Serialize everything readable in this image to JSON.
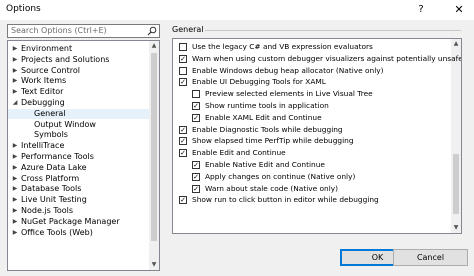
{
  "window": {
    "title": "Options",
    "help_glyph": "?",
    "close_glyph": "✕"
  },
  "search": {
    "placeholder": "Search Options (Ctrl+E)"
  },
  "tree": {
    "items": [
      {
        "label": "Environment",
        "arrow": "▶",
        "level": 0
      },
      {
        "label": "Projects and Solutions",
        "arrow": "▶",
        "level": 0
      },
      {
        "label": "Source Control",
        "arrow": "▶",
        "level": 0
      },
      {
        "label": "Work Items",
        "arrow": "▶",
        "level": 0
      },
      {
        "label": "Text Editor",
        "arrow": "▶",
        "level": 0
      },
      {
        "label": "Debugging",
        "arrow": "◢",
        "level": 0
      },
      {
        "label": "General",
        "arrow": "",
        "level": 1,
        "selected": true
      },
      {
        "label": "Output Window",
        "arrow": "",
        "level": 1
      },
      {
        "label": "Symbols",
        "arrow": "",
        "level": 1
      },
      {
        "label": "IntelliTrace",
        "arrow": "▶",
        "level": 0
      },
      {
        "label": "Performance Tools",
        "arrow": "▶",
        "level": 0
      },
      {
        "label": "Azure Data Lake",
        "arrow": "▶",
        "level": 0
      },
      {
        "label": "Cross Platform",
        "arrow": "▶",
        "level": 0
      },
      {
        "label": "Database Tools",
        "arrow": "▶",
        "level": 0
      },
      {
        "label": "Live Unit Testing",
        "arrow": "▶",
        "level": 0
      },
      {
        "label": "Node.js Tools",
        "arrow": "▶",
        "level": 0
      },
      {
        "label": "NuGet Package Manager",
        "arrow": "▶",
        "level": 0
      },
      {
        "label": "Office Tools (Web)",
        "arrow": "▶",
        "level": 0
      }
    ]
  },
  "section_title": "General",
  "options": [
    {
      "label": "Use the legacy C# and VB expression evaluators",
      "checked": false,
      "level": 0
    },
    {
      "label": "Warn when using custom debugger visualizers against potentially unsafe pr",
      "checked": true,
      "level": 0
    },
    {
      "label": "Enable Windows debug heap allocator (Native only)",
      "checked": false,
      "level": 0
    },
    {
      "label": "Enable UI Debugging Tools for XAML",
      "checked": true,
      "level": 0
    },
    {
      "label": "Preview selected elements in Live Visual Tree",
      "checked": false,
      "level": 1
    },
    {
      "label": "Show runtime tools in application",
      "checked": true,
      "level": 1
    },
    {
      "label": "Enable XAML Edit and Continue",
      "checked": true,
      "level": 1
    },
    {
      "label": "Enable Diagnostic Tools while debugging",
      "checked": true,
      "level": 0
    },
    {
      "label": "Show elapsed time PerfTip while debugging",
      "checked": true,
      "level": 0
    },
    {
      "label": "Enable Edit and Continue",
      "checked": true,
      "level": 0
    },
    {
      "label": "Enable Native Edit and Continue",
      "checked": true,
      "level": 1
    },
    {
      "label": "Apply changes on continue (Native only)",
      "checked": true,
      "level": 1
    },
    {
      "label": "Warn about stale code (Native only)",
      "checked": true,
      "level": 1
    },
    {
      "label": "Show run to click button in editor while debugging",
      "checked": true,
      "level": 0
    }
  ],
  "scroll_glyphs": {
    "up": "▲",
    "down": "▼"
  },
  "check_glyph": "✓",
  "buttons": {
    "ok": "OK",
    "cancel": "Cancel"
  }
}
